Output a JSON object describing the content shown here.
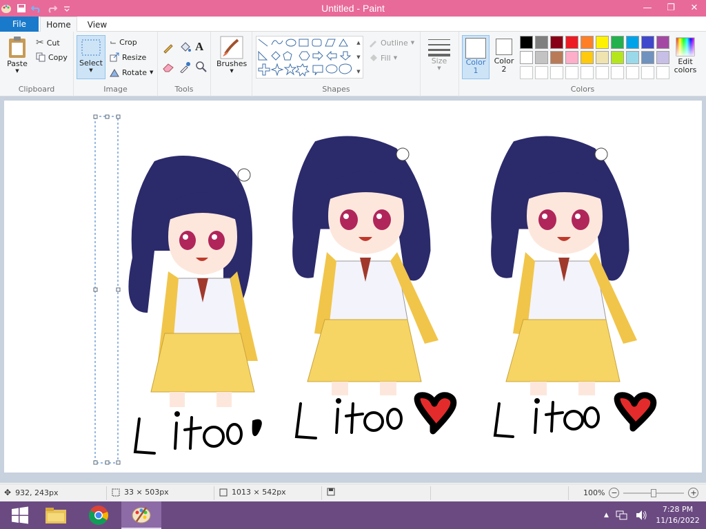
{
  "window": {
    "title": "Untitled - Paint"
  },
  "tabs": {
    "file": "File",
    "home": "Home",
    "view": "View"
  },
  "clipboard": {
    "paste": "Paste",
    "cut": "Cut",
    "copy": "Copy",
    "label": "Clipboard"
  },
  "image": {
    "select": "Select",
    "crop": "Crop",
    "resize": "Resize",
    "rotate": "Rotate",
    "label": "Image"
  },
  "tools": {
    "label": "Tools"
  },
  "brushes": {
    "label": "Brushes"
  },
  "shapes": {
    "outline": "Outline",
    "fill": "Fill",
    "label": "Shapes"
  },
  "size": {
    "label": "Size"
  },
  "colors": {
    "color1": "Color 1",
    "color2": "Color 2",
    "edit": "Edit colors",
    "label": "Colors",
    "row1": [
      "#000000",
      "#7f7f7f",
      "#880015",
      "#ed1c24",
      "#ff7f27",
      "#fff200",
      "#22b14c",
      "#00a2e8",
      "#3f48cc",
      "#a349a4"
    ],
    "row2": [
      "#ffffff",
      "#c3c3c3",
      "#b97a57",
      "#ffaec9",
      "#ffc90e",
      "#efe4b0",
      "#b5e61d",
      "#99d9ea",
      "#7092be",
      "#c8bfe7"
    ]
  },
  "canvas": {
    "caption": "Lito"
  },
  "status": {
    "cursor": "932, 243px",
    "selection": "33 × 503px",
    "image_size": "1013 × 542px",
    "zoom": "100%"
  },
  "taskbar": {
    "time": "7:28 PM",
    "date": "11/16/2022"
  }
}
